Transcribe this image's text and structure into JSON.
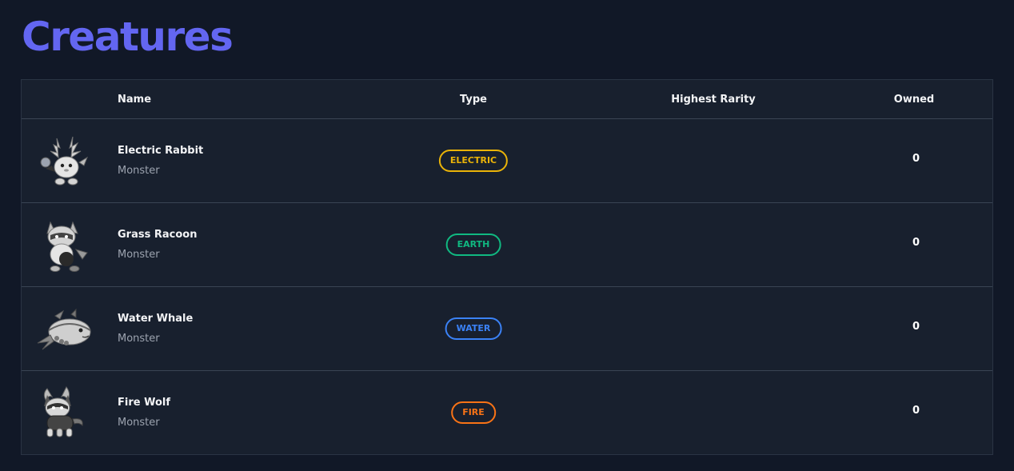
{
  "title": "Creatures",
  "columns": {
    "name": "Name",
    "type": "Type",
    "rarity": "Highest Rarity",
    "owned": "Owned"
  },
  "rows": [
    {
      "name": "Electric Rabbit",
      "kind": "Monster",
      "type": "ELECTRIC",
      "type_color": "#eab308",
      "owned": "0",
      "icon": "electric-rabbit-icon"
    },
    {
      "name": "Grass Racoon",
      "kind": "Monster",
      "type": "EARTH",
      "type_color": "#10b981",
      "owned": "0",
      "icon": "grass-racoon-icon"
    },
    {
      "name": "Water Whale",
      "kind": "Monster",
      "type": "WATER",
      "type_color": "#3b82f6",
      "owned": "0",
      "icon": "water-whale-icon"
    },
    {
      "name": "Fire Wolf",
      "kind": "Monster",
      "type": "FIRE",
      "type_color": "#f97316",
      "owned": "0",
      "icon": "fire-wolf-icon"
    }
  ],
  "colors": {
    "background": "#111827",
    "table": "#18202e",
    "accent": "#6366f1"
  }
}
